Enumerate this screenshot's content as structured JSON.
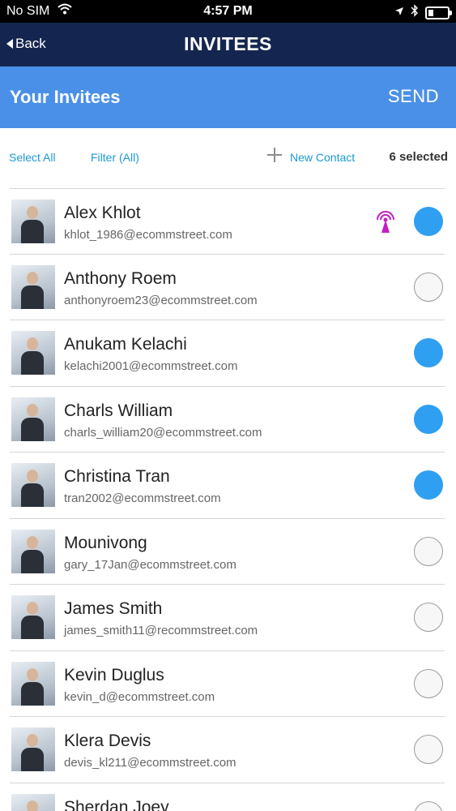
{
  "status_bar": {
    "carrier": "No SIM",
    "time": "4:57 PM",
    "icons": [
      "wifi-icon",
      "location-arrow-icon",
      "bluetooth-icon",
      "battery-icon"
    ]
  },
  "nav": {
    "back_label": "Back",
    "title": "INVITEES"
  },
  "header": {
    "title": "Your Invitees",
    "send_label": "SEND"
  },
  "toolbar": {
    "select_all": "Select All",
    "filter": "Filter (All)",
    "new_contact": "New Contact",
    "selected_count": "6 selected"
  },
  "colors": {
    "nav_background": "#14264f",
    "header_background": "#4a90e8",
    "link": "#1a9ad6",
    "selected_check": "#2f9ff2",
    "broadcast_icon": "#c21fc4"
  },
  "contacts": [
    {
      "name": "Alex Khlot",
      "email": "khlot_1986@ecommstreet.com",
      "selected": true,
      "badge": "broadcast-icon"
    },
    {
      "name": "Anthony Roem",
      "email": "anthonyroem23@ecommstreet.com",
      "selected": false
    },
    {
      "name": "Anukam Kelachi",
      "email": "kelachi2001@ecommstreet.com",
      "selected": true
    },
    {
      "name": "Charls William",
      "email": "charls_william20@ecommstreet.com",
      "selected": true
    },
    {
      "name": "Christina Tran",
      "email": "tran2002@ecommstreet.com",
      "selected": true
    },
    {
      "name": "Mounivong",
      "email": "gary_17Jan@ecommstreet.com",
      "selected": false
    },
    {
      "name": "James Smith",
      "email": "james_smith11@recommstreet.com",
      "selected": false
    },
    {
      "name": "Kevin Duglus",
      "email": "kevin_d@ecommstreet.com",
      "selected": false
    },
    {
      "name": "Klera Devis",
      "email": "devis_kl211@ecommstreet.com",
      "selected": false
    },
    {
      "name": "Sherdan Joey",
      "email": "",
      "selected": false
    }
  ]
}
